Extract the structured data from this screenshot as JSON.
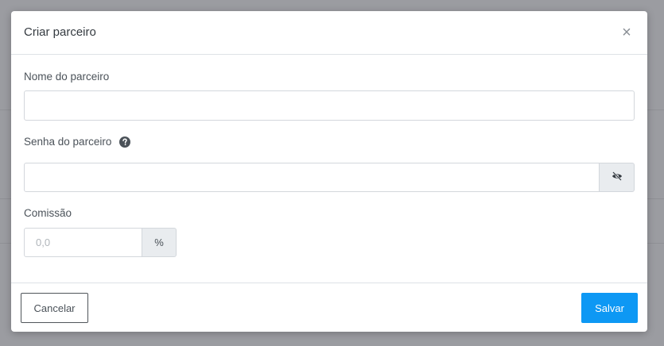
{
  "modal": {
    "title": "Criar parceiro",
    "close_label": "×"
  },
  "form": {
    "name": {
      "label": "Nome do parceiro",
      "value": "",
      "placeholder": ""
    },
    "password": {
      "label": "Senha do parceiro",
      "value": "",
      "placeholder": "",
      "help_icon": "question-circle-icon",
      "toggle_icon": "eye-slash-icon"
    },
    "commission": {
      "label": "Comissão",
      "value": "",
      "placeholder": "0,0",
      "suffix": "%"
    }
  },
  "footer": {
    "cancel_label": "Cancelar",
    "save_label": "Salvar"
  },
  "colors": {
    "primary": "#0d98f4",
    "backdrop": "#9b9ca1"
  }
}
